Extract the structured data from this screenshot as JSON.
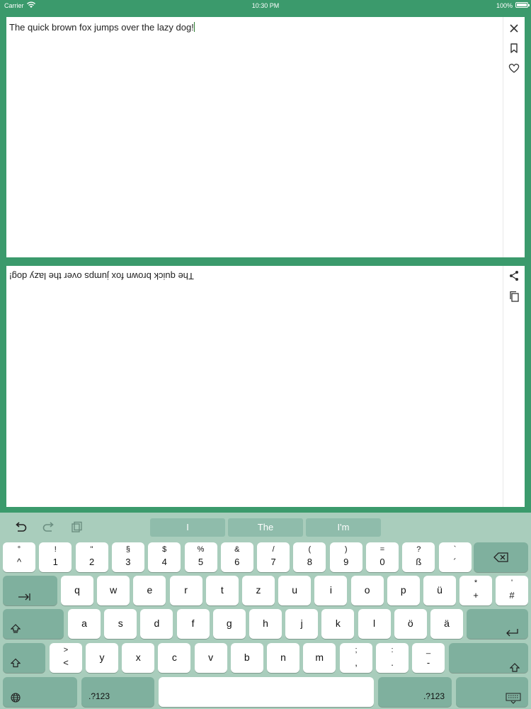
{
  "status": {
    "carrier": "Carrier",
    "time": "10:30 PM",
    "battery": "100%"
  },
  "input": {
    "text": "The quick brown fox jumps over the lazy dog!"
  },
  "output": {
    "text": "The quick brown fox jumps over the lazy dog!"
  },
  "top_icons": [
    "close-icon",
    "bookmark-icon",
    "heart-icon"
  ],
  "bottom_icons": [
    "share-icon",
    "copy-icon"
  ],
  "suggestions": [
    "I",
    "The",
    "I'm"
  ],
  "keyboard": {
    "row1": [
      [
        "°",
        "^"
      ],
      [
        "!",
        "1"
      ],
      [
        "\"",
        "2"
      ],
      [
        "§",
        "3"
      ],
      [
        "$",
        "4"
      ],
      [
        "%",
        "5"
      ],
      [
        "&",
        "6"
      ],
      [
        "/",
        "7"
      ],
      [
        "(",
        "8"
      ],
      [
        ")",
        "9"
      ],
      [
        "=",
        "0"
      ],
      [
        "?",
        "ß"
      ],
      [
        "`",
        "´"
      ]
    ],
    "row2": [
      "q",
      "w",
      "e",
      "r",
      "t",
      "z",
      "u",
      "i",
      "o",
      "p",
      "ü"
    ],
    "row2_extra": [
      [
        "*",
        "+"
      ],
      [
        "'",
        "#"
      ]
    ],
    "row3": [
      "a",
      "s",
      "d",
      "f",
      "g",
      "h",
      "j",
      "k",
      "l",
      "ö",
      "ä"
    ],
    "row4_sym": [
      [
        ">",
        "<"
      ]
    ],
    "row4": [
      "y",
      "x",
      "c",
      "v",
      "b",
      "n",
      "m"
    ],
    "row4_punct": [
      [
        ";",
        ","
      ],
      [
        ":",
        "."
      ],
      [
        "_",
        "-"
      ]
    ],
    "numbers_label": ".?123"
  }
}
